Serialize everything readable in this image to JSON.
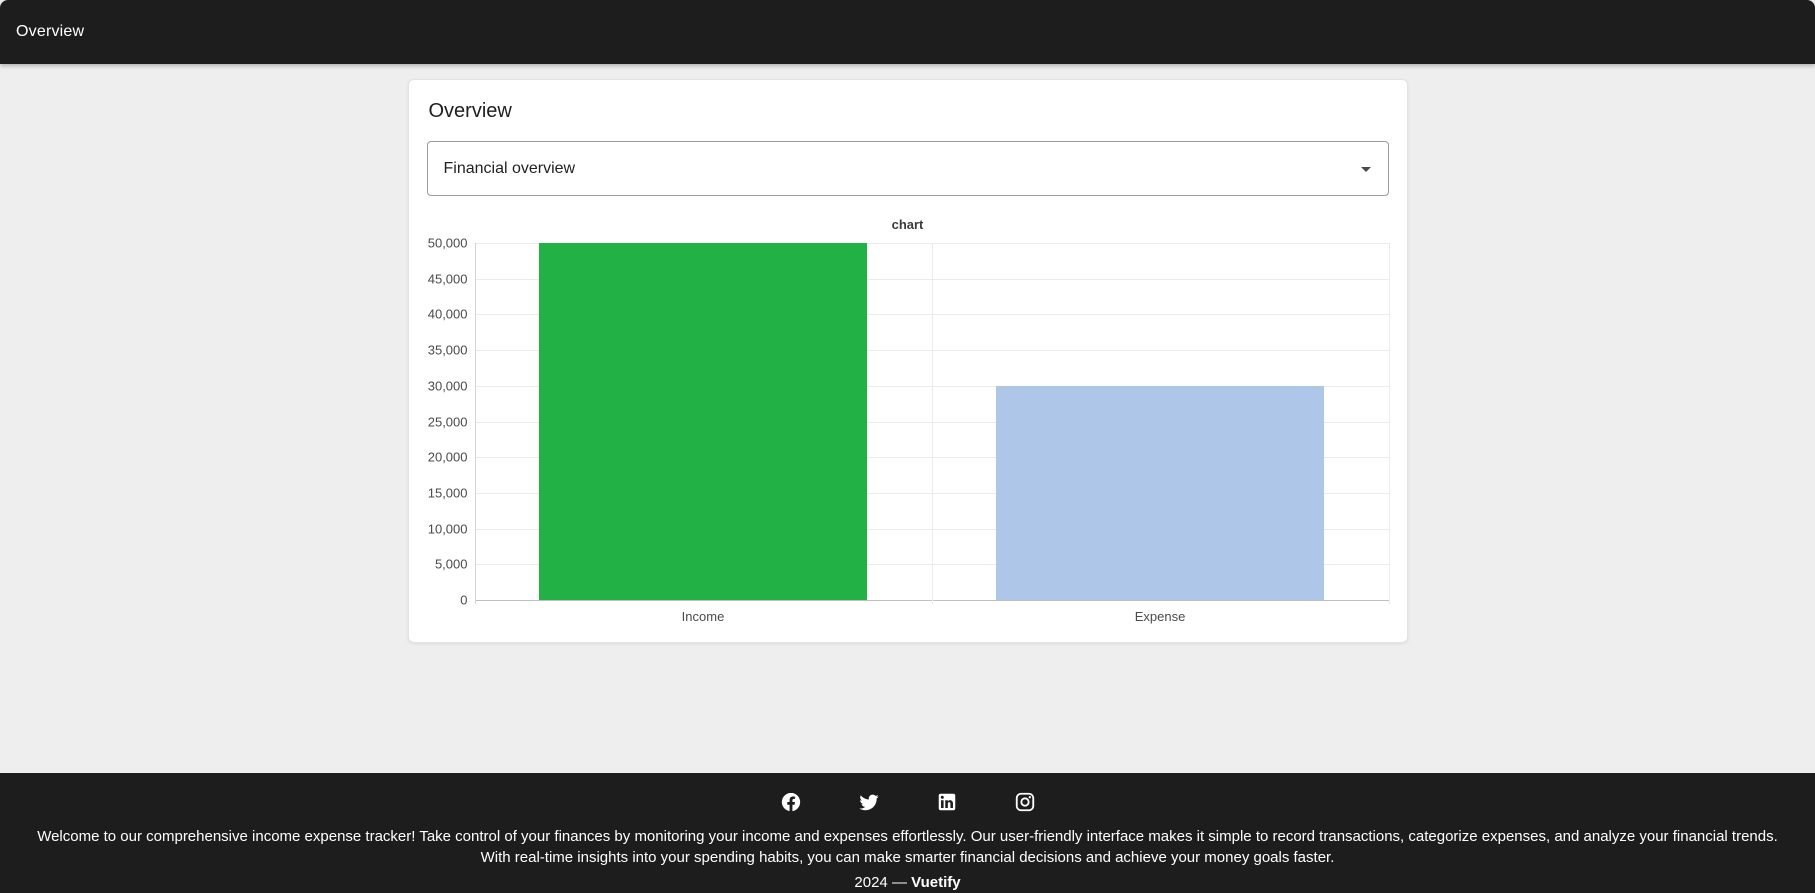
{
  "app_bar": {
    "title": "Overview"
  },
  "card": {
    "title": "Overview",
    "select": {
      "value": "Financial overview"
    }
  },
  "chart_data": {
    "type": "bar",
    "title": "chart",
    "categories": [
      "Income",
      "Expense"
    ],
    "values": [
      50000,
      30000
    ],
    "series_colors": [
      "#21b144",
      "#aec6e8"
    ],
    "xlabel": "",
    "ylabel": "",
    "ylim": [
      0,
      50000
    ],
    "ytick_step": 5000,
    "ytick_labels": [
      "0",
      "5,000",
      "10,000",
      "15,000",
      "20,000",
      "25,000",
      "30,000",
      "35,000",
      "40,000",
      "45,000",
      "50,000"
    ],
    "grid": true,
    "legend": "none"
  },
  "footer": {
    "social": [
      {
        "name": "facebook"
      },
      {
        "name": "twitter"
      },
      {
        "name": "linkedin"
      },
      {
        "name": "instagram"
      }
    ],
    "description": "Welcome to our comprehensive income expense tracker! Take control of your finances by monitoring your income and expenses effortlessly. Our user-friendly interface makes it simple to record transactions, categorize expenses, and analyze your financial trends. With real-time insights into your spending habits, you can make smarter financial decisions and achieve your money goals faster.",
    "copyright": {
      "prefix": "2024 —",
      "brand": "Vuetify"
    }
  },
  "colors": {
    "app_bar_bg": "#1d1d1d",
    "page_bg": "#eeeeee",
    "card_bg": "#ffffff",
    "income_bar": "#21b144",
    "expense_bar": "#aec6e8"
  }
}
